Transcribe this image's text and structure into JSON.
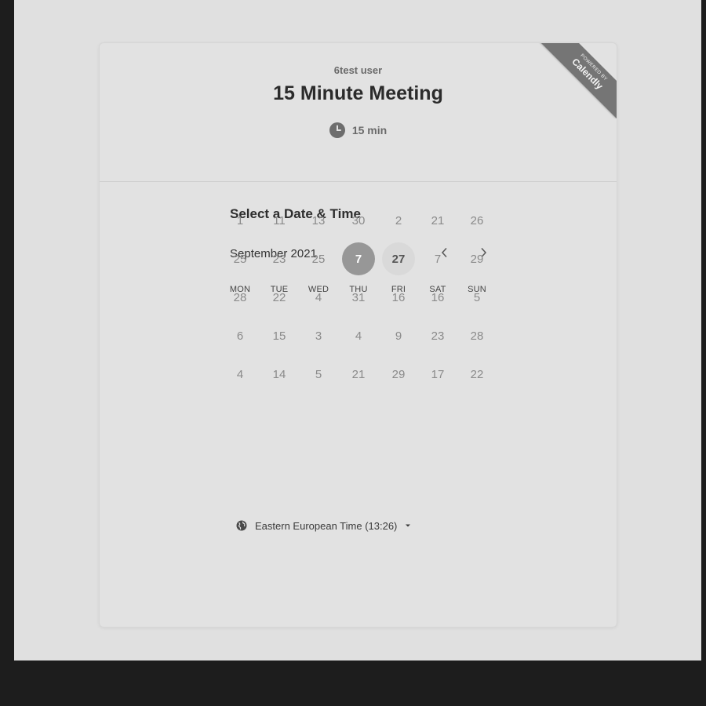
{
  "header": {
    "host_name": "6test user",
    "event_title": "15 Minute Meeting",
    "duration": "15 min",
    "duration_icon": "clock-icon"
  },
  "badge": {
    "small_text": "POWERED BY",
    "brand": "Calendly"
  },
  "scheduler": {
    "title": "Select a Date & Time",
    "month_label": "September 2021",
    "prev_icon": "chevron-left-icon",
    "next_icon": "chevron-right-icon",
    "weekdays": [
      "MON",
      "TUE",
      "WED",
      "THU",
      "FRI",
      "SAT",
      "SUN"
    ],
    "weeks": [
      [
        "1",
        "11",
        "13",
        "30",
        "2",
        "21",
        "26"
      ],
      [
        "25",
        "23",
        "25",
        "7",
        "27",
        "7",
        "29"
      ],
      [
        "28",
        "22",
        "4",
        "31",
        "16",
        "16",
        "5"
      ],
      [
        "6",
        "15",
        "3",
        "4",
        "9",
        "23",
        "28"
      ],
      [
        "4",
        "14",
        "5",
        "21",
        "29",
        "17",
        "22"
      ]
    ],
    "selected_day": "7",
    "available_days": [
      "27"
    ]
  },
  "timezone": {
    "label": "Eastern European Time (13:26)",
    "icon": "globe-icon",
    "dropdown_icon": "caret-down-icon"
  }
}
